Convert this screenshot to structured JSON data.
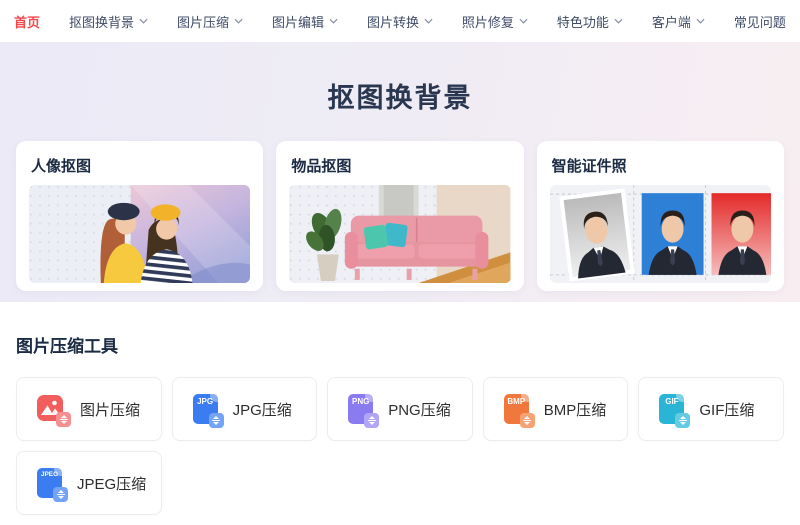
{
  "nav": {
    "items": [
      {
        "label": "首页",
        "active": true,
        "chevron": false
      },
      {
        "label": "抠图换背景",
        "active": false,
        "chevron": true
      },
      {
        "label": "图片压缩",
        "active": false,
        "chevron": true
      },
      {
        "label": "图片编辑",
        "active": false,
        "chevron": true
      },
      {
        "label": "图片转换",
        "active": false,
        "chevron": true
      },
      {
        "label": "照片修复",
        "active": false,
        "chevron": true
      },
      {
        "label": "特色功能",
        "active": false,
        "chevron": true
      },
      {
        "label": "客户端",
        "active": false,
        "chevron": true
      },
      {
        "label": "常见问题",
        "active": false,
        "chevron": false
      }
    ]
  },
  "hero": {
    "title": "抠图换背景",
    "cards": [
      {
        "title": "人像抠图"
      },
      {
        "title": "物品抠图"
      },
      {
        "title": "智能证件照"
      }
    ]
  },
  "compress_section": {
    "title": "图片压缩工具",
    "tools": [
      {
        "label": "图片压缩",
        "icon": "image-compress-icon",
        "color": "#f25d5d"
      },
      {
        "label": "JPG压缩",
        "badge": "JPG",
        "icon": "jpg-file-icon",
        "color": "#3b7cf0"
      },
      {
        "label": "PNG压缩",
        "badge": "PNG",
        "icon": "png-file-icon",
        "color": "#8b7bf0"
      },
      {
        "label": "BMP压缩",
        "badge": "BMP",
        "icon": "bmp-file-icon",
        "color": "#f0783c"
      },
      {
        "label": "GIF压缩",
        "badge": "GIF",
        "icon": "gif-file-icon",
        "color": "#2ab5d6"
      },
      {
        "label": "JPEG压缩",
        "badge": "JPEG",
        "icon": "jpeg-file-icon",
        "color": "#3b7cf0"
      }
    ]
  },
  "colors": {
    "active_nav": "#f5484c",
    "nav_text": "#3f4b66",
    "heading": "#1c2b44",
    "hero_bg_left": "#ebeaf6",
    "hero_bg_right": "#f8eef2"
  }
}
